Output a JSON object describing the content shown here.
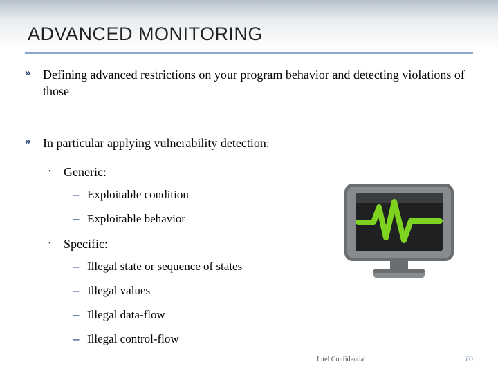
{
  "title": "ADVANCED MONITORING",
  "bullets": {
    "l1a": "Defining advanced restrictions on your program behavior and detecting violations of those",
    "l1b": "In particular applying vulnerability detection:",
    "generic": "Generic:",
    "g1": "Exploitable condition",
    "g2": "Exploitable behavior",
    "specific": "Specific:",
    "s1": "Illegal state or sequence of states",
    "s2": "Illegal values",
    "s3": "Illegal data-flow",
    "s4": "Illegal control-flow"
  },
  "footer": {
    "confidential": "Intel Confidential",
    "page": "70"
  }
}
